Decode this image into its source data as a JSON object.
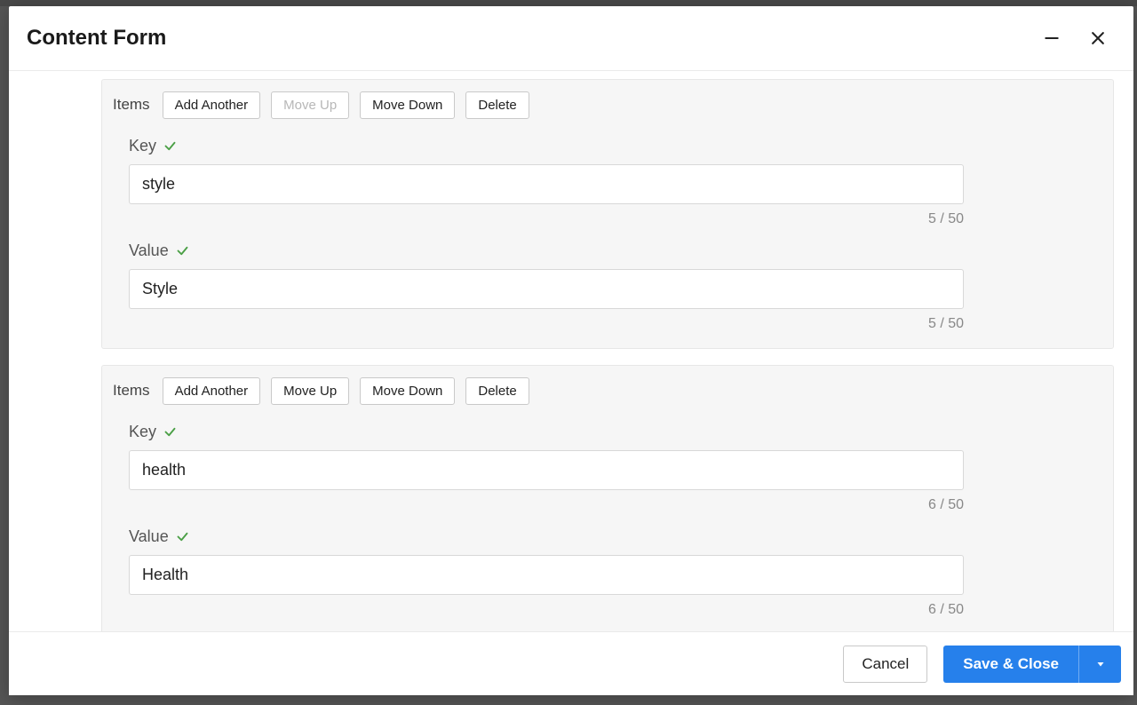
{
  "modal": {
    "title": "Content Form",
    "footer": {
      "cancel": "Cancel",
      "save": "Save & Close"
    }
  },
  "items": [
    {
      "toolbar": {
        "label": "Items",
        "add": "Add Another",
        "up": "Move Up",
        "down": "Move Down",
        "delete": "Delete",
        "up_disabled": true
      },
      "key_label": "Key",
      "key_value": "style",
      "key_counter": "5 / 50",
      "value_label": "Value",
      "value_value": "Style",
      "value_counter": "5 / 50"
    },
    {
      "toolbar": {
        "label": "Items",
        "add": "Add Another",
        "up": "Move Up",
        "down": "Move Down",
        "delete": "Delete",
        "up_disabled": false
      },
      "key_label": "Key",
      "key_value": "health",
      "key_counter": "6 / 50",
      "value_label": "Value",
      "value_value": "Health",
      "value_counter": "6 / 50"
    }
  ]
}
